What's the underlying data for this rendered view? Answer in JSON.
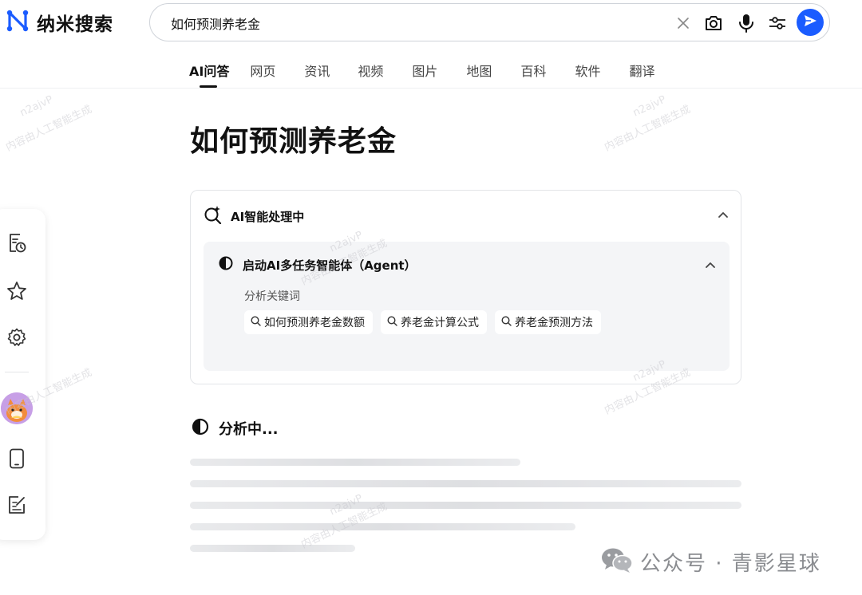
{
  "brand": {
    "name": "纳米搜索",
    "accent": "#1b5cff"
  },
  "search": {
    "query": "如何预测养老金"
  },
  "tabs": [
    {
      "label": "AI问答",
      "active": true
    },
    {
      "label": "网页"
    },
    {
      "label": "资讯"
    },
    {
      "label": "视频"
    },
    {
      "label": "图片"
    },
    {
      "label": "地图"
    },
    {
      "label": "百科"
    },
    {
      "label": "软件"
    },
    {
      "label": "翻译"
    }
  ],
  "main": {
    "title": "如何预测养老金",
    "processing": {
      "label": "AI智能处理中",
      "agent": {
        "label": "启动AI多任务智能体（Agent）",
        "step": "分析关键词",
        "keywords": [
          "如何预测养老金数额",
          "养老金计算公式",
          "养老金预测方法"
        ]
      }
    },
    "analyzing_label": "分析中..."
  },
  "sidebar": {
    "icons": [
      "history-icon",
      "star-icon",
      "gear-icon",
      "avatar",
      "phone-icon",
      "note-edit-icon"
    ]
  },
  "watermark": {
    "footer": "公众号 · 青影星球",
    "overlay_lines": [
      "n2ajvP",
      "内容由人工智能生成"
    ]
  }
}
